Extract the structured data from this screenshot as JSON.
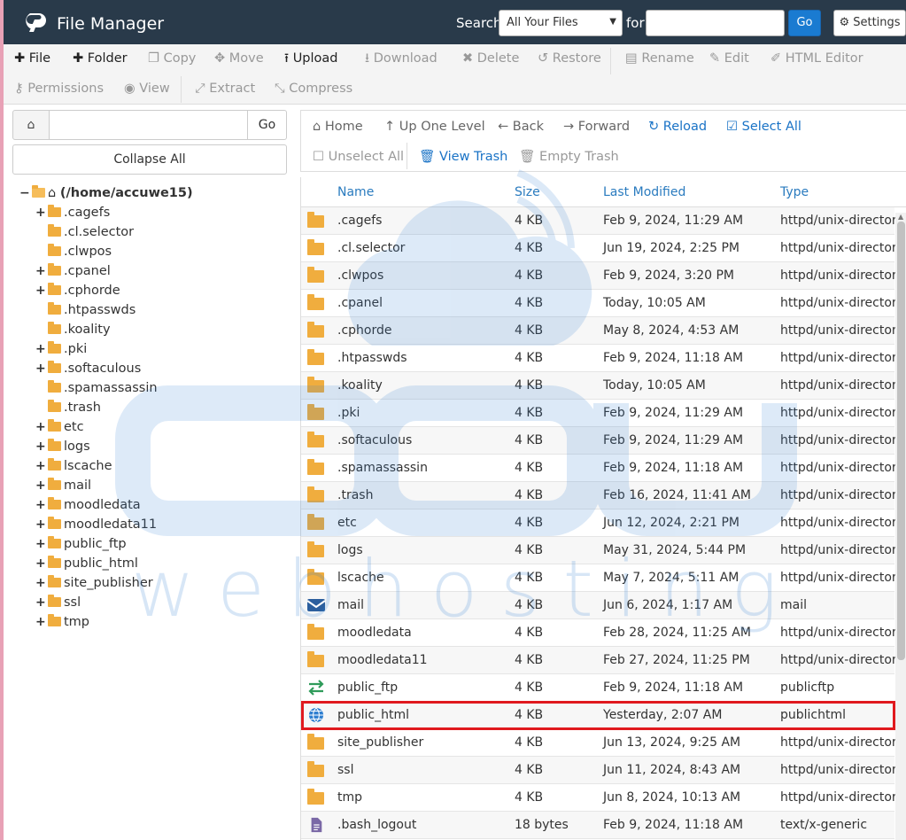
{
  "header": {
    "app_title": "File Manager",
    "search_label": "Search",
    "search_scope": "All Your Files",
    "for_label": "for",
    "search_placeholder": "",
    "go_label": "Go",
    "settings_label": "Settings"
  },
  "toolbar": {
    "file": "File",
    "folder": "Folder",
    "copy": "Copy",
    "move": "Move",
    "upload": "Upload",
    "download": "Download",
    "delete": "Delete",
    "restore": "Restore",
    "rename": "Rename",
    "edit": "Edit",
    "html_editor": "HTML Editor",
    "permissions": "Permissions",
    "view": "View",
    "extract": "Extract",
    "compress": "Compress"
  },
  "left": {
    "path_value": "",
    "go_label": "Go",
    "collapse_label": "Collapse All",
    "root_label": "(/home/accuwe15)",
    "tree": [
      {
        "label": ".cagefs",
        "expandable": true
      },
      {
        "label": ".cl.selector",
        "expandable": false
      },
      {
        "label": ".clwpos",
        "expandable": false
      },
      {
        "label": ".cpanel",
        "expandable": true
      },
      {
        "label": ".cphorde",
        "expandable": true
      },
      {
        "label": ".htpasswds",
        "expandable": false
      },
      {
        "label": ".koality",
        "expandable": false
      },
      {
        "label": ".pki",
        "expandable": true
      },
      {
        "label": ".softaculous",
        "expandable": true
      },
      {
        "label": ".spamassassin",
        "expandable": false
      },
      {
        "label": ".trash",
        "expandable": false
      },
      {
        "label": "etc",
        "expandable": true
      },
      {
        "label": "logs",
        "expandable": true
      },
      {
        "label": "lscache",
        "expandable": true
      },
      {
        "label": "mail",
        "expandable": true
      },
      {
        "label": "moodledata",
        "expandable": true
      },
      {
        "label": "moodledata11",
        "expandable": true
      },
      {
        "label": "public_ftp",
        "expandable": true
      },
      {
        "label": "public_html",
        "expandable": true
      },
      {
        "label": "site_publisher",
        "expandable": true
      },
      {
        "label": "ssl",
        "expandable": true
      },
      {
        "label": "tmp",
        "expandable": true
      }
    ]
  },
  "right_toolbar": {
    "home": "Home",
    "up_one_level": "Up One Level",
    "back": "Back",
    "forward": "Forward",
    "reload": "Reload",
    "select_all": "Select All",
    "unselect_all": "Unselect All",
    "view_trash": "View Trash",
    "empty_trash": "Empty Trash"
  },
  "table": {
    "columns": [
      "Name",
      "Size",
      "Last Modified",
      "Type"
    ],
    "rows": [
      {
        "icon": "folder-icon",
        "name": ".cagefs",
        "size": "4 KB",
        "modified": "Feb 9, 2024, 11:29 AM",
        "type": "httpd/unix-directory"
      },
      {
        "icon": "folder-icon",
        "name": ".cl.selector",
        "size": "4 KB",
        "modified": "Jun 19, 2024, 2:25 PM",
        "type": "httpd/unix-directory"
      },
      {
        "icon": "folder-icon",
        "name": ".clwpos",
        "size": "4 KB",
        "modified": "Feb 9, 2024, 3:20 PM",
        "type": "httpd/unix-directory"
      },
      {
        "icon": "folder-icon",
        "name": ".cpanel",
        "size": "4 KB",
        "modified": "Today, 10:05 AM",
        "type": "httpd/unix-directory"
      },
      {
        "icon": "folder-icon",
        "name": ".cphorde",
        "size": "4 KB",
        "modified": "May 8, 2024, 4:53 AM",
        "type": "httpd/unix-directory"
      },
      {
        "icon": "folder-icon",
        "name": ".htpasswds",
        "size": "4 KB",
        "modified": "Feb 9, 2024, 11:18 AM",
        "type": "httpd/unix-directory"
      },
      {
        "icon": "folder-icon",
        "name": ".koality",
        "size": "4 KB",
        "modified": "Today, 10:05 AM",
        "type": "httpd/unix-directory"
      },
      {
        "icon": "folder-icon",
        "name": ".pki",
        "size": "4 KB",
        "modified": "Feb 9, 2024, 11:29 AM",
        "type": "httpd/unix-directory"
      },
      {
        "icon": "folder-icon",
        "name": ".softaculous",
        "size": "4 KB",
        "modified": "Feb 9, 2024, 11:29 AM",
        "type": "httpd/unix-directory"
      },
      {
        "icon": "folder-icon",
        "name": ".spamassassin",
        "size": "4 KB",
        "modified": "Feb 9, 2024, 11:18 AM",
        "type": "httpd/unix-directory"
      },
      {
        "icon": "folder-icon",
        "name": ".trash",
        "size": "4 KB",
        "modified": "Feb 16, 2024, 11:41 AM",
        "type": "httpd/unix-directory"
      },
      {
        "icon": "folder-icon",
        "name": "etc",
        "size": "4 KB",
        "modified": "Jun 12, 2024, 2:21 PM",
        "type": "httpd/unix-directory"
      },
      {
        "icon": "folder-icon",
        "name": "logs",
        "size": "4 KB",
        "modified": "May 31, 2024, 5:44 PM",
        "type": "httpd/unix-directory"
      },
      {
        "icon": "folder-icon",
        "name": "lscache",
        "size": "4 KB",
        "modified": "May 7, 2024, 5:11 AM",
        "type": "httpd/unix-directory"
      },
      {
        "icon": "mail-icon",
        "name": "mail",
        "size": "4 KB",
        "modified": "Jun 6, 2024, 1:17 AM",
        "type": "mail"
      },
      {
        "icon": "folder-icon",
        "name": "moodledata",
        "size": "4 KB",
        "modified": "Feb 28, 2024, 11:25 AM",
        "type": "httpd/unix-directory"
      },
      {
        "icon": "folder-icon",
        "name": "moodledata11",
        "size": "4 KB",
        "modified": "Feb 27, 2024, 11:25 PM",
        "type": "httpd/unix-directory"
      },
      {
        "icon": "transfer-icon",
        "name": "public_ftp",
        "size": "4 KB",
        "modified": "Feb 9, 2024, 11:18 AM",
        "type": "publicftp"
      },
      {
        "icon": "globe-icon",
        "name": "public_html",
        "size": "4 KB",
        "modified": "Yesterday, 2:07 AM",
        "type": "publichtml",
        "highlighted": true
      },
      {
        "icon": "folder-icon",
        "name": "site_publisher",
        "size": "4 KB",
        "modified": "Jun 13, 2024, 9:25 AM",
        "type": "httpd/unix-directory"
      },
      {
        "icon": "folder-icon",
        "name": "ssl",
        "size": "4 KB",
        "modified": "Jun 11, 2024, 8:43 AM",
        "type": "httpd/unix-directory"
      },
      {
        "icon": "folder-icon",
        "name": "tmp",
        "size": "4 KB",
        "modified": "Jun 8, 2024, 10:13 AM",
        "type": "httpd/unix-directory"
      },
      {
        "icon": "file-icon",
        "name": ".bash_logout",
        "size": "18 bytes",
        "modified": "Feb 9, 2024, 11:18 AM",
        "type": "text/x-generic"
      }
    ]
  },
  "colors": {
    "header_bg": "#293a4a",
    "accent_blue": "#1a7bd1",
    "folder": "#f0ad3e",
    "highlight_border": "#e0191e"
  },
  "watermark": {
    "brand": "accu",
    "tagline": "webhosting"
  }
}
